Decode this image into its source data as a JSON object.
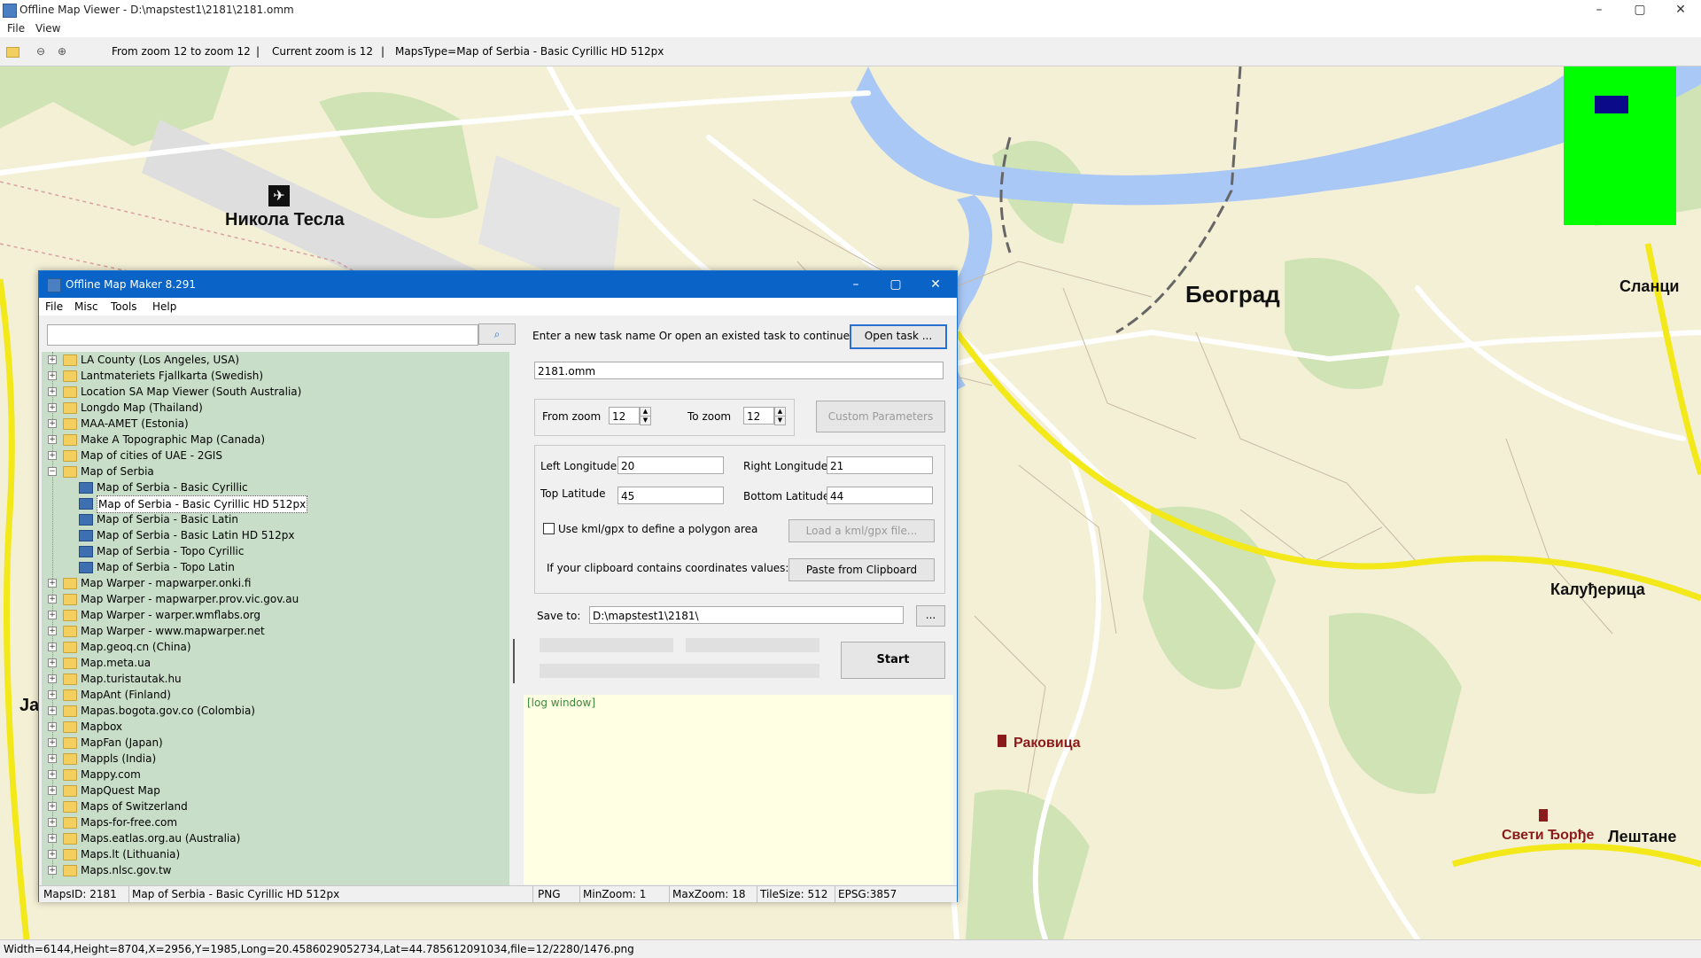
{
  "app": {
    "title": "Offline Map Viewer - D:\\mapstest1\\2181\\2181.omm",
    "window_controls": [
      "–",
      "▢",
      "✕"
    ],
    "menu": [
      "File",
      "View"
    ],
    "toolbar": {
      "zoom_range": "From zoom 12 to zoom 12",
      "current_zoom": "Current zoom is 12",
      "maps_type": "MapsType=Map of Serbia - Basic Cyrillic HD 512px"
    },
    "status": "Width=6144,Height=8704,X=2956,Y=1985,Long=20.4586029052734,Lat=44.785612091034,file=12/2280/1476.png"
  },
  "map": {
    "labels": [
      "Никола Тесла",
      "Београд",
      "Сланци",
      "Калуђерица",
      "Раковица",
      "Свети Ђорђе",
      "Лештане",
      "Ja"
    ],
    "colors": {
      "land": "#f4f0d6",
      "water": "#a9c8f5",
      "green": "#cfe3b4",
      "road": "#ffffff",
      "highway": "#f2e81a",
      "minimap": "#00ff00",
      "minimap_view": "#0b0b8a"
    }
  },
  "dialog": {
    "title": "Offline Map Maker 8.291",
    "menu": [
      "File",
      "Misc",
      "Tools",
      "Help"
    ],
    "search": {
      "value": "",
      "placeholder": ""
    },
    "tree": [
      {
        "label": "LA County (Los Angeles, USA)",
        "level": 0
      },
      {
        "label": "Lantmateriets Fjallkarta (Swedish)",
        "level": 0
      },
      {
        "label": "Location SA Map Viewer (South Australia)",
        "level": 0
      },
      {
        "label": "Longdo Map (Thailand)",
        "level": 0
      },
      {
        "label": "MAA-AMET (Estonia)",
        "level": 0
      },
      {
        "label": "Make A Topographic Map (Canada)",
        "level": 0
      },
      {
        "label": "Map of cities of UAE - 2GIS",
        "level": 0
      },
      {
        "label": "Map of Serbia",
        "level": 0,
        "open": true
      },
      {
        "label": "Map of Serbia - Basic Cyrillic",
        "level": 1
      },
      {
        "label": "Map of Serbia - Basic Cyrillic HD 512px",
        "level": 1,
        "selected": true
      },
      {
        "label": "Map of Serbia - Basic Latin",
        "level": 1
      },
      {
        "label": "Map of Serbia - Basic Latin HD 512px",
        "level": 1
      },
      {
        "label": "Map of Serbia - Topo Cyrillic",
        "level": 1
      },
      {
        "label": "Map of Serbia - Topo Latin",
        "level": 1
      },
      {
        "label": "Map Warper - mapwarper.onki.fi",
        "level": 0
      },
      {
        "label": "Map Warper - mapwarper.prov.vic.gov.au",
        "level": 0
      },
      {
        "label": "Map Warper - warper.wmflabs.org",
        "level": 0
      },
      {
        "label": "Map Warper - www.mapwarper.net",
        "level": 0
      },
      {
        "label": "Map.geoq.cn (China)",
        "level": 0
      },
      {
        "label": "Map.meta.ua",
        "level": 0
      },
      {
        "label": "Map.turistautak.hu",
        "level": 0
      },
      {
        "label": "MapAnt (Finland)",
        "level": 0
      },
      {
        "label": "Mapas.bogota.gov.co (Colombia)",
        "level": 0
      },
      {
        "label": "Mapbox",
        "level": 0
      },
      {
        "label": "MapFan (Japan)",
        "level": 0
      },
      {
        "label": "Mappls (India)",
        "level": 0
      },
      {
        "label": "Mappy.com",
        "level": 0
      },
      {
        "label": "MapQuest Map",
        "level": 0
      },
      {
        "label": "Maps of Switzerland",
        "level": 0
      },
      {
        "label": "Maps-for-free.com",
        "level": 0
      },
      {
        "label": "Maps.eatlas.org.au (Australia)",
        "level": 0
      },
      {
        "label": "Maps.lt (Lithuania)",
        "level": 0
      },
      {
        "label": "Maps.nlsc.gov.tw",
        "level": 0
      }
    ],
    "task_prompt": "Enter a new task name Or open an existed task to continue:",
    "open_task_btn": "Open task ...",
    "task_name": "2181.omm",
    "from_zoom_label": "From zoom",
    "from_zoom": "12",
    "to_zoom_label": "To zoom",
    "to_zoom": "12",
    "custom_params_btn": "Custom Parameters",
    "left_lon_label": "Left Longitude",
    "left_lon": "20",
    "right_lon_label": "Right Longitude",
    "right_lon": "21",
    "top_lat_label": "Top Latitude",
    "top_lat": "45",
    "bottom_lat_label": "Bottom Latitude",
    "bottom_lat": "44",
    "kml_label": "Use kml/gpx to define a polygon area",
    "load_kml_btn": "Load a kml/gpx file...",
    "clipboard_label": "If your clipboard contains coordinates values:",
    "paste_btn": "Paste from Clipboard",
    "save_to_label": "Save to:",
    "save_to": "D:\\mapstest1\\2181\\",
    "browse_btn": "...",
    "start_btn": "Start",
    "log": "[log window]",
    "status": {
      "maps_id": "MapsID: 2181",
      "map_name": "Map of Serbia - Basic Cyrillic HD 512px",
      "format": "PNG",
      "min_zoom": "MinZoom: 1",
      "max_zoom": "MaxZoom: 18",
      "tile_size": "TileSize: 512",
      "epsg": "EPSG:3857"
    }
  }
}
